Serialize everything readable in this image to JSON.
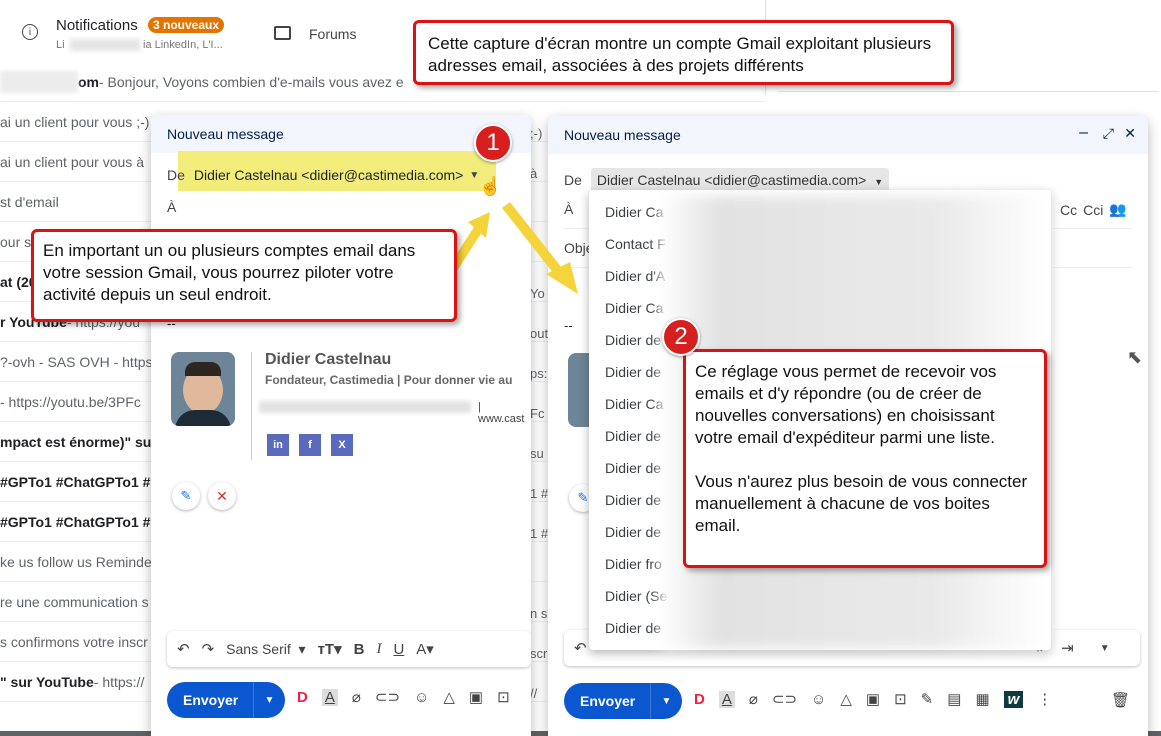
{
  "topbar": {
    "notif_label": "Notifications",
    "notif_badge": "3 nouveaux",
    "notif_sub_a": "Li",
    "notif_sub_b": "ia LinkedIn, L'I...",
    "forums_label": "Forums"
  },
  "inbox_rows": [
    {
      "bold": "om",
      "text": " - Bonjour, Voyons combien d'e-mails vous avez e"
    },
    {
      "bold": "",
      "text": "ai un client pour vous ;-)"
    },
    {
      "bold": "",
      "text": "ai un client pour vous à"
    },
    {
      "bold": "",
      "text": "st d'email"
    },
    {
      "bold": "",
      "text": "our s"
    },
    {
      "bold": "at (20",
      "text": ""
    },
    {
      "bold": "r YouTube",
      "text": " - https://you"
    },
    {
      "bold": "",
      "text": "?-ovh - SAS OVH - https:"
    },
    {
      "bold": "",
      "text": "- https://youtu.be/3PFc"
    },
    {
      "bold": "mpact est énorme)\" su",
      "text": ""
    },
    {
      "bold": "#GPTo1 #ChatGPTo1 #",
      "text": ""
    },
    {
      "bold": "#GPTo1 #ChatGPTo1 #",
      "text": ""
    },
    {
      "bold": "",
      "text": "ke us follow us Reminde"
    },
    {
      "bold": "",
      "text": "re une communication s"
    },
    {
      "bold": "",
      "text": "s confirmons votre inscr"
    },
    {
      "bold": "\" sur YouTube",
      "text": " - https://"
    }
  ],
  "mid_col": [
    ";-)",
    "à",
    "",
    "",
    "Yo",
    "out",
    "ps:",
    "Fc",
    "su",
    "1 #",
    "1 #",
    "",
    "n s",
    "scr",
    "//"
  ],
  "compose1": {
    "title": "Nouveau message",
    "from_label": "De",
    "from_value": "Didier Castelnau <didier@castimedia.com>",
    "to_label": "À",
    "sig_sep": "--",
    "sig_name": "Didier Castelnau",
    "sig_title": "Fondateur, Castimedia | Pour donner vie au",
    "sig_site": "www.cast",
    "social": [
      "in",
      "f",
      "X"
    ],
    "font": "Sans Serif",
    "send": "Envoyer"
  },
  "compose2": {
    "title": "Nouveau message",
    "from_label": "De",
    "from_value": "Didier Castelnau <didier@castimedia.com>",
    "to_label": "À",
    "cc": "Cc",
    "cci": "Cci",
    "subject": "Obje",
    "sig_sep": "--",
    "send": "Envoyer"
  },
  "dropdown": [
    "Didier Ca",
    "Contact F",
    "Didier d'A",
    "Didier Ca",
    "Didier de",
    "Didier de",
    "Didier Ca",
    "Didier de",
    "Didier de",
    "Didier de",
    "Didier de",
    "Didier fro",
    "Didier (Se",
    "Didier de"
  ],
  "callouts": {
    "top": "Cette capture d'écran montre un compte Gmail exploitant plusieurs adresses email, associées à des projets différents",
    "left": "En important un ou plusieurs comptes email dans votre session Gmail, vous pourrez piloter votre activité depuis un seul endroit.",
    "right_p1": "Ce réglage vous permet de recevoir vos emails et d'y répondre (ou de créer de nouvelles conversations) en choisissant votre email d'expéditeur parmi une liste.",
    "right_p2": "Vous n'aurez plus besoin de vous connecter manuellement à chacune de vos boites email."
  },
  "badges": [
    "1",
    "2"
  ],
  "colors": {
    "accent": "#0b57d0",
    "callout_border": "#dd1111",
    "badge": "#d71f1f",
    "highlight": "#f2ec7a",
    "arrow": "#f5d33a"
  }
}
